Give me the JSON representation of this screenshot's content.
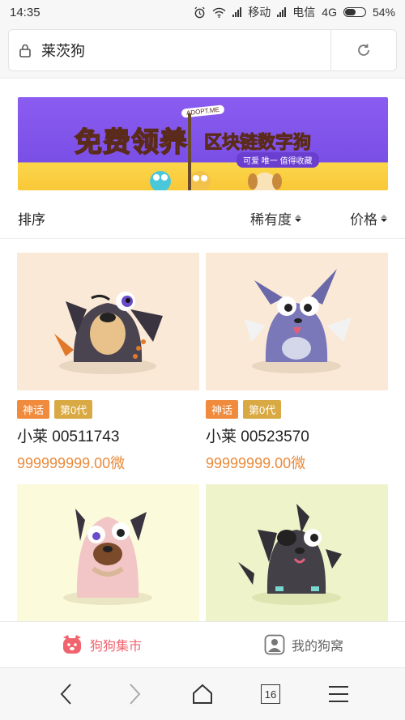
{
  "status_bar": {
    "time": "14:35",
    "carrier1": "移动",
    "carrier2": "电信",
    "network": "4G",
    "battery": "54%",
    "battery_level": 0.54
  },
  "address_bar": {
    "url_text": "莱茨狗"
  },
  "banner": {
    "adopt_badge": "ADOPT.ME",
    "title_main": "免费领养",
    "title_sub": "区块链数字狗",
    "tagline": "可爱 唯一 值得收藏"
  },
  "sort_bar": {
    "label": "排序",
    "rarity": "稀有度",
    "price": "价格"
  },
  "cards": [
    {
      "tag_rarity": "神话",
      "tag_generation": "第0代",
      "name": "小莱 00511743",
      "price": "999999999.00微",
      "bg": "#fbe9d8"
    },
    {
      "tag_rarity": "神话",
      "tag_generation": "第0代",
      "name": "小莱 00523570",
      "price": "99999999.00微",
      "bg": "#fbe9d8"
    },
    {
      "bg": "#fbfbdc"
    },
    {
      "bg": "#eef3c9"
    }
  ],
  "tab_bar": {
    "market": "狗狗集市",
    "my_kennel": "我的狗窝"
  },
  "nav_bar": {
    "tabs_count": "16"
  },
  "colors": {
    "accent_orange": "#e88a3a",
    "tab_active": "#f0646e",
    "tag_myth": "#f08a3c",
    "tag_gen": "#d9a943"
  }
}
